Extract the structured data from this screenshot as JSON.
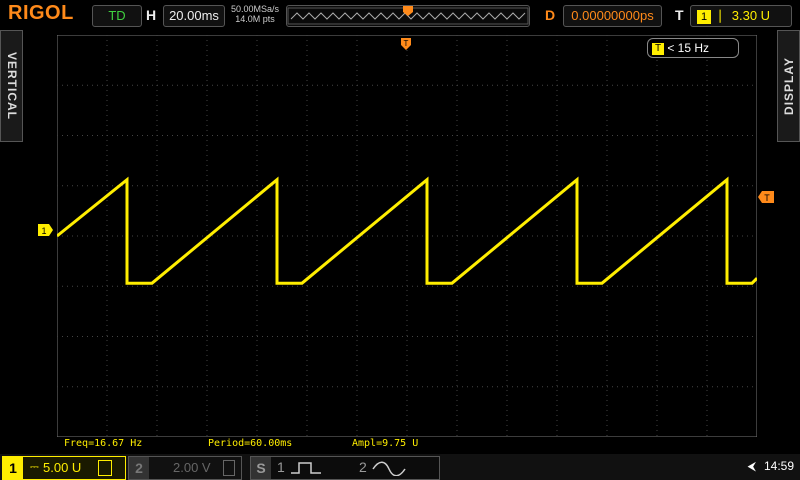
{
  "brand": "RIGOL",
  "topbar": {
    "run_state": "TD",
    "timebase_label": "H",
    "timebase": "20.00ms",
    "sample_rate": "50.00MSa/s",
    "memory_depth": "14.0M pts",
    "delay_label": "D",
    "delay": "0.00000000ps",
    "trigger_label": "T",
    "trigger_level": "3.30 U"
  },
  "side": {
    "left": "VERTICAL",
    "right": "DISPLAY"
  },
  "trigger_freq": "< 15 Hz",
  "measurements": {
    "freq": "Freq=16.67 Hz",
    "period": "Period=60.00ms",
    "ampl": "Ampl=9.75 U"
  },
  "channels": {
    "ch1": {
      "num": "1",
      "scale": "5.00 U"
    },
    "ch2": {
      "num": "2",
      "scale": "2.00 V"
    }
  },
  "sources": {
    "s_label": "S",
    "s1": "1",
    "s2": "2"
  },
  "clock": "14:59",
  "colors": {
    "ch1": "#ffee00",
    "accent": "#ff8a1a",
    "run": "#3fd13f"
  },
  "chart_data": {
    "type": "line",
    "title": "",
    "xlabel": "",
    "ylabel": "",
    "grid": true,
    "x_divisions": 14,
    "y_divisions": 8,
    "x_range_ms": [
      0,
      280
    ],
    "y_range_div": [
      -4,
      4
    ],
    "series": [
      {
        "x": [
          0,
          28,
          28,
          38,
          88,
          88,
          98,
          148,
          148,
          158,
          208,
          208,
          218,
          268,
          268,
          278,
          280
        ],
        "y": [
          0,
          1.12,
          -0.94,
          -0.94,
          1.12,
          -0.94,
          -0.94,
          1.12,
          -0.94,
          -0.94,
          1.12,
          -0.94,
          -0.94,
          1.12,
          -0.94,
          -0.94,
          -0.84
        ]
      }
    ]
  }
}
